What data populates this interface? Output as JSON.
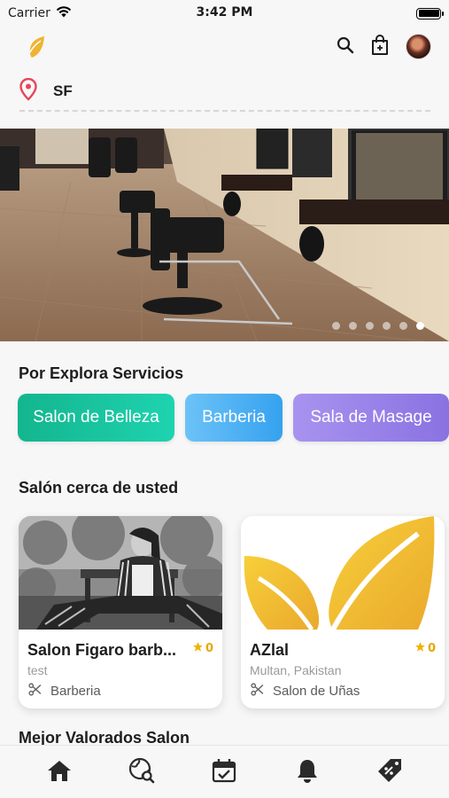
{
  "status_bar": {
    "carrier": "Carrier",
    "time": "3:42 PM"
  },
  "header": {
    "location": "SF"
  },
  "banner": {
    "slide_count": 6,
    "active_slide": 6
  },
  "services": {
    "title": "Por Explora Servicios",
    "items": [
      {
        "label": "Salon de Belleza",
        "colors": [
          "#13b58e",
          "#1fd3b0"
        ]
      },
      {
        "label": "Barberia",
        "colors": [
          "#57b7f5",
          "#35a2ef"
        ]
      },
      {
        "label": "Sala de Masage",
        "colors": [
          "#8f78e6",
          "#a58ff0"
        ]
      }
    ]
  },
  "nearby": {
    "title": "Salón cerca de usted",
    "cards": [
      {
        "name": "Salon Figaro barb...",
        "subtitle": "test",
        "rating": "0",
        "category": "Barberia"
      },
      {
        "name": "AZlal",
        "subtitle": "Multan, Pakistan",
        "rating": "0",
        "category": "Salon de Uñas"
      }
    ]
  },
  "top_rated": {
    "title": "Mejor Valorados Salon"
  },
  "bottom_nav": {
    "items": [
      "home-icon",
      "explore-globe-icon",
      "calendar-icon",
      "bell-icon",
      "offers-tag-icon"
    ]
  },
  "colors": {
    "accent": "#f0b430",
    "pin": "#e8455a",
    "star": "#f0b400"
  }
}
